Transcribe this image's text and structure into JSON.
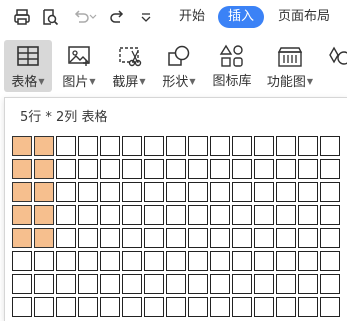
{
  "quick_access": {
    "icons": [
      "print-icon",
      "print-preview-icon",
      "undo-icon",
      "redo-icon",
      "more-dropdown-icon"
    ]
  },
  "menu": {
    "tabs": [
      {
        "label": "开始",
        "active": false
      },
      {
        "label": "插入",
        "active": true
      },
      {
        "label": "页面布局",
        "active": false
      }
    ]
  },
  "ribbon": {
    "table": "表格",
    "image": "图片",
    "screenshot": "截屏",
    "shapes": "形状",
    "icon_library": "图标库",
    "function_chart": "功能图"
  },
  "table_picker": {
    "title": "5行 * 2列 表格",
    "rows": 8,
    "cols": 15,
    "selected_rows": 5,
    "selected_cols": 2,
    "highlight_color": "#f6bf8e"
  },
  "colors": {
    "accent": "#3b82f6"
  }
}
